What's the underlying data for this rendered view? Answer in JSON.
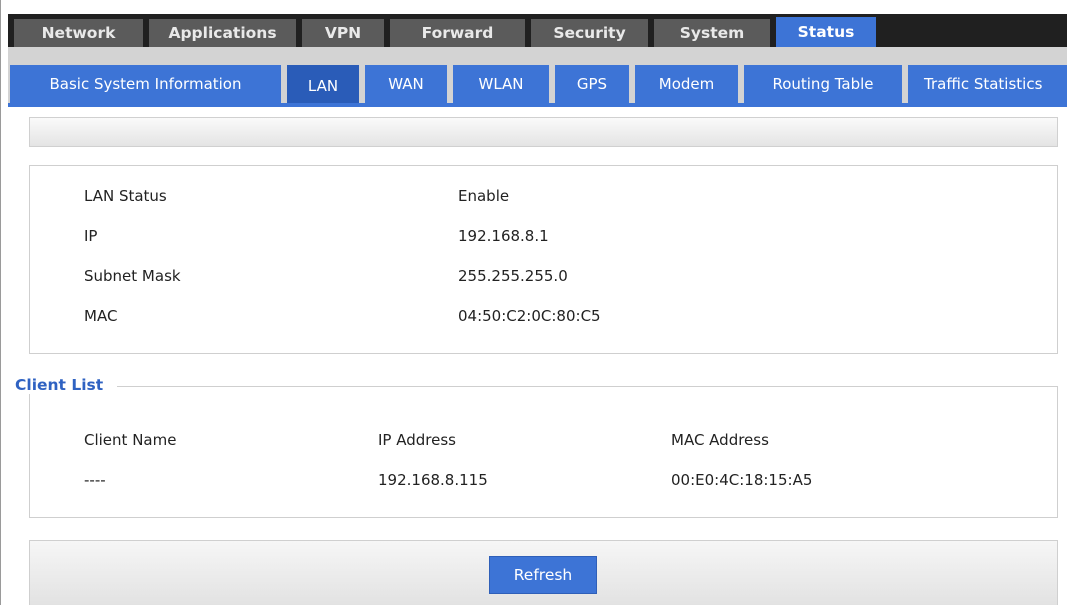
{
  "top_tabs": [
    "Network",
    "Applications",
    "VPN",
    "Forward",
    "Security",
    "System",
    "Status"
  ],
  "active_top_tab": "Status",
  "sub_tabs": [
    "Basic System Information",
    "LAN",
    "WAN",
    "WLAN",
    "GPS",
    "Modem",
    "Routing Table",
    "Traffic Statistics"
  ],
  "active_sub_tab": "LAN",
  "lan_info": [
    {
      "label": "LAN Status",
      "value": "Enable"
    },
    {
      "label": "IP",
      "value": "192.168.8.1"
    },
    {
      "label": "Subnet Mask",
      "value": "255.255.255.0"
    },
    {
      "label": "MAC",
      "value": "04:50:C2:0C:80:C5"
    }
  ],
  "client_list": {
    "title": "Client List",
    "columns": [
      "Client Name",
      "IP Address",
      "MAC Address"
    ],
    "rows": [
      [
        "----",
        "192.168.8.115",
        "00:E0:4C:18:15:A5"
      ]
    ]
  },
  "refresh_label": "Refresh",
  "colors": {
    "accent": "#3d74d6",
    "topbar": "#202020",
    "tab": "#5b5b5b",
    "legend": "#2f62c2"
  }
}
